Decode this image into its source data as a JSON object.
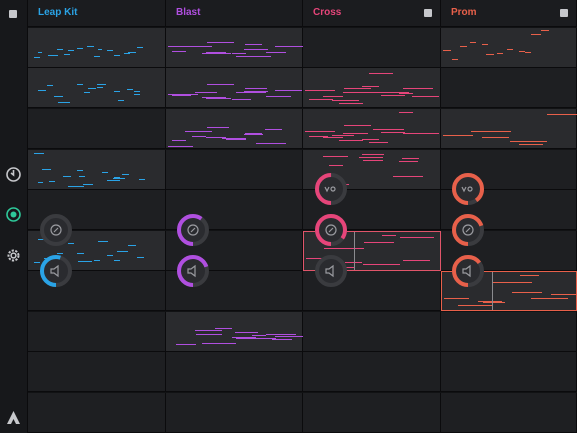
{
  "tracks": [
    {
      "name": "Leap Kit",
      "color": "#2aa3e6"
    },
    {
      "name": "Blast",
      "color": "#b04fe0"
    },
    {
      "name": "Cross",
      "color": "#e6457a"
    },
    {
      "name": "Prom",
      "color": "#e8604a"
    }
  ],
  "sidebar": {
    "icons": [
      "stop-all-icon",
      "clock-icon",
      "record-icon",
      "settings-icon",
      "logo-icon"
    ],
    "accent": "#2ec99a"
  },
  "knobs": {
    "leap": {
      "filter_level": 0.0,
      "volume_level": 0.55
    },
    "blast": {
      "filter_level": 0.6,
      "volume_level": 0.7
    },
    "cross": {
      "fx_level": 0.5,
      "filter_level": 0.85,
      "volume_level": 0.0
    },
    "prom": {
      "fx_level": 0.9,
      "filter_level": 0.7,
      "volume_level": 0.65
    }
  }
}
